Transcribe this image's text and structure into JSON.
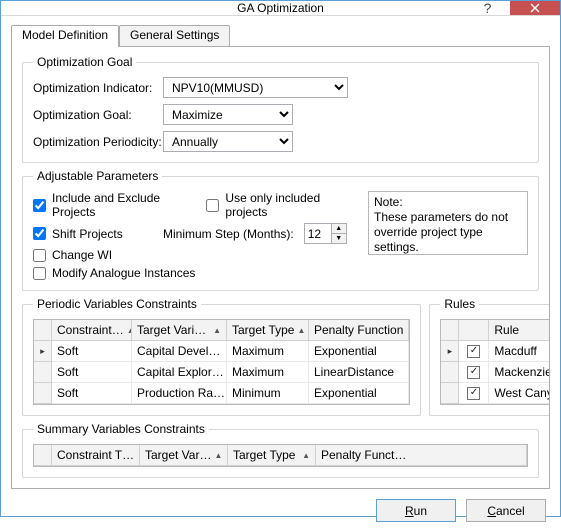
{
  "window": {
    "title": "GA Optimization"
  },
  "tabs": {
    "model_def": "Model Definition",
    "general": "General Settings"
  },
  "opt_goal": {
    "legend": "Optimization Goal",
    "indicator_label": "Optimization Indicator:",
    "indicator_value": "NPV10(MMUSD)",
    "goal_label": "Optimization Goal:",
    "goal_value": "Maximize",
    "periodicity_label": "Optimization Periodicity:",
    "periodicity_value": "Annually"
  },
  "adj_params": {
    "legend": "Adjustable Parameters",
    "include_exclude": "Include and Exclude Projects",
    "include_exclude_checked": true,
    "use_only_included": "Use only included projects",
    "use_only_included_checked": false,
    "shift_projects": "Shift Projects",
    "shift_projects_checked": true,
    "min_step_label": "Minimum Step (Months):",
    "min_step_value": "12",
    "change_wi": "Change WI",
    "change_wi_checked": false,
    "modify_analogue": "Modify Analogue Instances",
    "modify_analogue_checked": false,
    "note_title": "Note:",
    "note_body": "These parameters do not override project type settings."
  },
  "pvc": {
    "legend": "Periodic Variables Constraints",
    "headers": {
      "constraint": "Constraint…",
      "target_var": "Target Vari…",
      "target_type": "Target Type",
      "penalty": "Penalty Function"
    },
    "rows": [
      {
        "selected": true,
        "constraint": "Soft",
        "target_var": "Capital Devel…",
        "target_type": "Maximum",
        "penalty": "Exponential"
      },
      {
        "selected": false,
        "constraint": "Soft",
        "target_var": "Capital Explor…",
        "target_type": "Maximum",
        "penalty": "LinearDistance"
      },
      {
        "selected": false,
        "constraint": "Soft",
        "target_var": "Production Ra…",
        "target_type": "Minimum",
        "penalty": "Exponential"
      }
    ]
  },
  "rules": {
    "legend": "Rules",
    "header": "Rule",
    "rows": [
      {
        "selected": true,
        "checked": true,
        "name": "Macduff"
      },
      {
        "selected": false,
        "checked": true,
        "name": "Mackenzie"
      },
      {
        "selected": false,
        "checked": true,
        "name": "West Canyon"
      }
    ]
  },
  "svc": {
    "legend": "Summary Variables Constraints",
    "headers": {
      "constraint": "Constraint T…",
      "target_var": "Target Var…",
      "target_type": "Target Type",
      "penalty": "Penalty Funct…"
    }
  },
  "buttons": {
    "run": "un",
    "cancel": "ancel"
  }
}
